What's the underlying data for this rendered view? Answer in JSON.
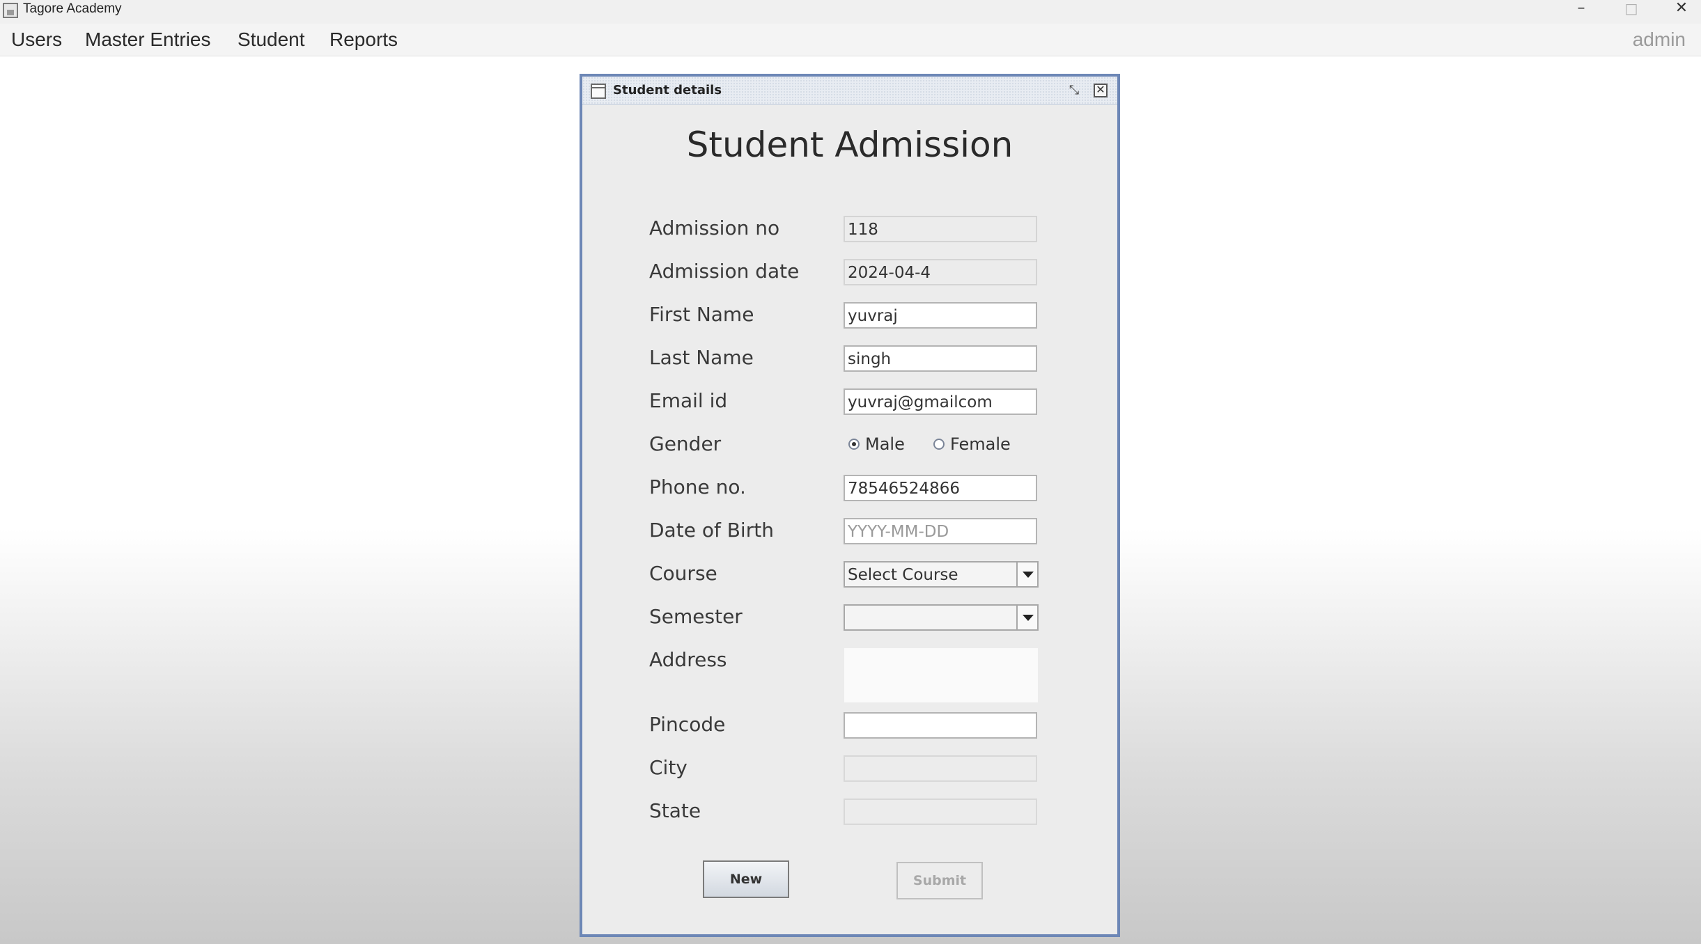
{
  "window": {
    "title": "Tagore Academy",
    "minimize": "–",
    "maximize": "□",
    "close": "✕"
  },
  "menu": {
    "items": [
      "Users",
      "Master Entries",
      "Student",
      "Reports"
    ],
    "user": "admin"
  },
  "frame": {
    "title": "Student details",
    "restore_glyph": "⤡",
    "close_glyph": "✕"
  },
  "form": {
    "heading": "Student Admission",
    "labels": {
      "admission_no": "Admission no",
      "admission_date": "Admission date",
      "first_name": "First Name",
      "last_name": "Last Name",
      "email": "Email id",
      "gender": "Gender",
      "phone": "Phone no.",
      "dob": "Date of Birth",
      "course": "Course",
      "semester": "Semester",
      "address": "Address",
      "pincode": "Pincode",
      "city": "City",
      "state": "State"
    },
    "values": {
      "admission_no": "118",
      "admission_date": "2024-04-4",
      "first_name": "yuvraj",
      "last_name": "singh",
      "email": "yuvraj@gmailcom",
      "phone": "78546524866",
      "dob_placeholder": "YYYY-MM-DD",
      "course": "Select Course",
      "semester": "",
      "address": "",
      "pincode": "",
      "city": "",
      "state": ""
    },
    "gender_options": {
      "male": "Male",
      "female": "Female",
      "selected": "Male"
    },
    "buttons": {
      "new": "New",
      "submit": "Submit"
    }
  }
}
